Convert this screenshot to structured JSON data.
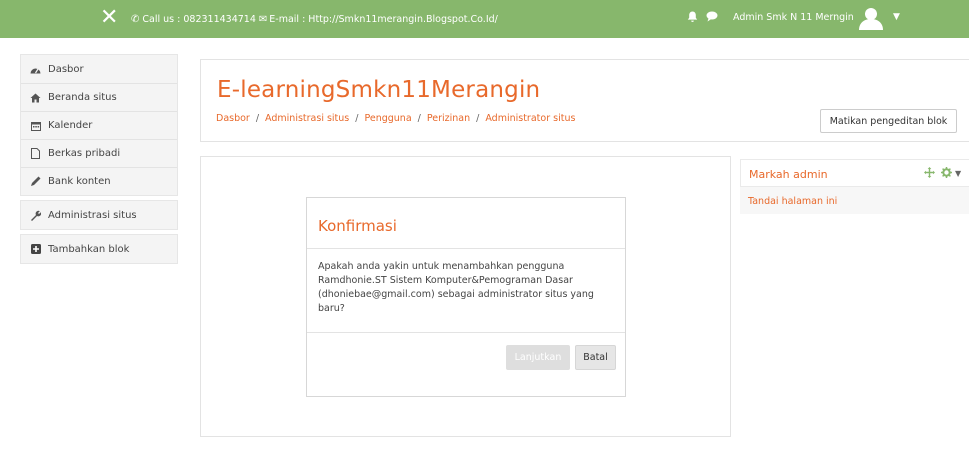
{
  "navbar": {
    "close_glyph": "✕",
    "contact_text": "Call us : 082311434714",
    "email_text": "E-mail : Http://Smkn11merangin.Blogspot.Co.Id/",
    "user_name": "Admin Smk N 11 Merngin",
    "icons": [
      "close-icon",
      "phone-icon",
      "mail-icon",
      "bell-icon",
      "chat-icon",
      "user-avatar-icon",
      "caret-down-icon"
    ],
    "color": "#87b76c"
  },
  "sidebar": {
    "group1": [
      {
        "label": "Dasbor",
        "icon": "dashboard-icon"
      },
      {
        "label": "Beranda situs",
        "icon": "home-icon"
      },
      {
        "label": "Kalender",
        "icon": "calendar-icon"
      },
      {
        "label": "Berkas pribadi",
        "icon": "file-icon"
      },
      {
        "label": "Bank konten",
        "icon": "pencil-icon"
      }
    ],
    "group2": [
      {
        "label": "Administrasi situs",
        "icon": "wrench-icon"
      }
    ],
    "group3": [
      {
        "label": "Tambahkan blok",
        "icon": "plus-square-icon"
      }
    ]
  },
  "header": {
    "title": "E-learningSmkn11Merangin",
    "breadcrumb": [
      "Dasbor",
      "Administrasi situs",
      "Pengguna",
      "Perizinan",
      "Administrator situs"
    ],
    "breadcrumb_separator": "/",
    "edit_button": "Matikan pengeditan blok",
    "accent_color": "#e8692b"
  },
  "dialog": {
    "title": "Konfirmasi",
    "message": "Apakah anda yakin untuk menambahkan pengguna Ramdhonie.ST Sistem Komputer&Pemograman Dasar (dhoniebae@gmail.com) sebagai administrator situs yang baru?",
    "continue_button": "Lanjutkan",
    "cancel_button": "Batal"
  },
  "admin_block": {
    "title": "Markah admin",
    "link": "Tandai halaman ini"
  }
}
